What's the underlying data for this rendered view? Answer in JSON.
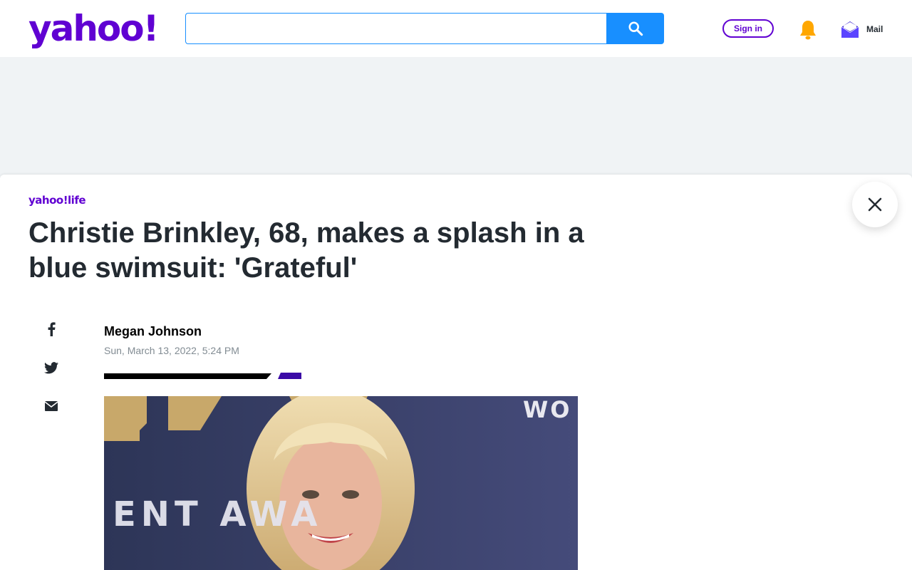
{
  "header": {
    "logo_text": "yahoo!",
    "search": {
      "value": "",
      "placeholder": ""
    },
    "sign_in_label": "Sign in",
    "mail_label": "Mail"
  },
  "article": {
    "brand": "yahoo!life",
    "title": "Christie Brinkley, 68, makes a splash in a blue swimsuit: 'Grateful'",
    "author": "Megan Johnson",
    "date": "Sun, March 13, 2022, 5:24 PM",
    "share_icons": [
      "facebook-icon",
      "twitter-icon",
      "email-icon"
    ]
  },
  "photo": {
    "backdrop_text_top": "WO",
    "backdrop_text_mid": "ENT AWA"
  },
  "colors": {
    "brand_purple": "#6001d2",
    "search_blue": "#188fff",
    "bell_yellow": "#ffa700",
    "text_dark": "#232a31",
    "text_muted": "#828c93",
    "page_bg": "#f0f3f5"
  }
}
